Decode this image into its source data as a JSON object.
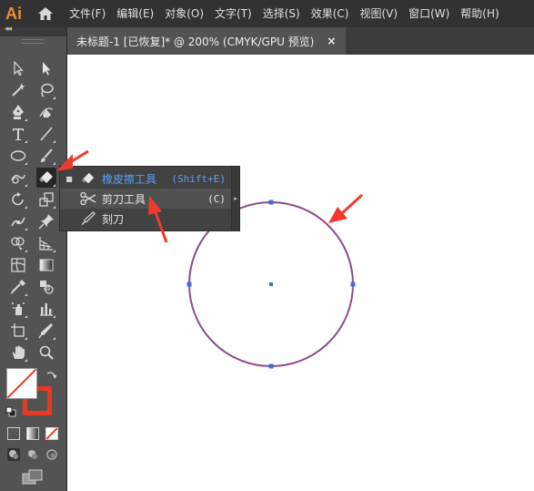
{
  "app": {
    "logo": "Ai",
    "home_icon": "home-icon"
  },
  "menu": [
    {
      "label": "文件(F)"
    },
    {
      "label": "编辑(E)"
    },
    {
      "label": "对象(O)"
    },
    {
      "label": "文字(T)"
    },
    {
      "label": "选择(S)"
    },
    {
      "label": "效果(C)"
    },
    {
      "label": "视图(V)"
    },
    {
      "label": "窗口(W)"
    },
    {
      "label": "帮助(H)"
    }
  ],
  "document_tab": {
    "title": "未标题-1 [已恢复]* @ 200% (CMYK/GPU 预览)",
    "close": "×"
  },
  "tools": {
    "collapse": "◂◂",
    "items": [
      "selection-tool",
      "direct-selection-tool",
      "magic-wand-tool",
      "lasso-tool",
      "pen-tool",
      "curvature-tool",
      "type-tool",
      "line-segment-tool",
      "ellipse-tool",
      "paintbrush-tool",
      "shaper-tool",
      "eraser-tool",
      "rotate-tool",
      "scale-tool",
      "puppet-warp-tool",
      "free-transform-tool",
      "shape-builder-tool",
      "perspective-grid-tool",
      "mesh-tool",
      "gradient-tool",
      "eyedropper-tool",
      "blend-tool",
      "symbol-sprayer-tool",
      "column-graph-tool",
      "artboard-tool",
      "slice-tool",
      "hand-tool",
      "zoom-tool"
    ],
    "active": "eraser-tool"
  },
  "colors": {
    "fill": "#ffffff",
    "stroke": "#e83a22",
    "circle_stroke": "#8e4a8a",
    "anchor": "#3b6fe0",
    "annotation_arrow": "#f03a2e"
  },
  "flyout": {
    "items": [
      {
        "name": "eraser",
        "label": "橡皮擦工具",
        "shortcut": "(Shift+E)",
        "current": true,
        "color": "#5aa0f0"
      },
      {
        "name": "scissors",
        "label": "剪刀工具",
        "shortcut": "(C)",
        "current": false
      },
      {
        "name": "knife",
        "label": "刻刀",
        "shortcut": "",
        "current": false
      }
    ],
    "bullet": "■",
    "tearoff": "▸"
  }
}
